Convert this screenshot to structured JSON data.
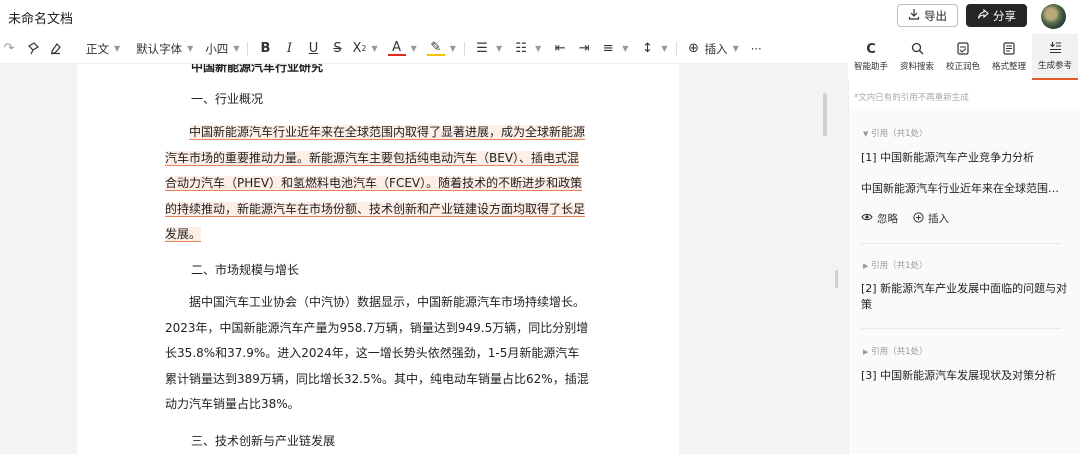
{
  "app": {
    "doc_title": "未命名文档"
  },
  "header": {
    "export_label": "导出",
    "share_label": "分享"
  },
  "toolbar": {
    "paragraph_style": "正文",
    "font_family": "默认字体",
    "font_size": "小四",
    "insert_label": "插入",
    "more_label": "···"
  },
  "side_tabs": [
    {
      "label": "智能助手",
      "icon": "assistant-logo-icon"
    },
    {
      "label": "资料搜索",
      "icon": "search-icon"
    },
    {
      "label": "校正润色",
      "icon": "proofread-icon"
    },
    {
      "label": "格式整理",
      "icon": "format-icon"
    },
    {
      "label": "生成参考",
      "icon": "reference-icon",
      "active": true
    }
  ],
  "document": {
    "clipped_heading": "中国新能源汽车行业研究",
    "section1": "一、行业概况",
    "para1": "中国新能源汽车行业近年来在全球范围内取得了显著进展，成为全球新能源汽车市场的重要推动力量。新能源汽车主要包括纯电动汽车（BEV）、插电式混合动力汽车（PHEV）和氢燃料电池汽车（FCEV）。随着技术的不断进步和政策的持续推动，新能源汽车在市场份额、技术创新和产业链建设方面均取得了长足发展。",
    "section2": "二、市场规模与增长",
    "para2": "据中国汽车工业协会（中汽协）数据显示，中国新能源汽车市场持续增长。2023年，中国新能源汽车产量为958.7万辆，销量达到949.5万辆，同比分别增长35.8%和37.9%。进入2024年，这一增长势头依然强劲，1-5月新能源汽车累计销量达到389万辆，同比增长32.5%。其中，纯电动车销量占比62%，插混动力汽车销量占比38%。",
    "section3": "三、技术创新与产业链发展"
  },
  "panel": {
    "hint": "*文内已有的引用不再重新生成",
    "citations": [
      {
        "count_label": "引用（共1处）",
        "title": "[1] 中国新能源汽车产业竞争力分析",
        "snippet": "中国新能源汽车行业近年来在全球范围内取得了显著进展",
        "ignore_label": "忽略",
        "insert_label": "插入"
      },
      {
        "count_label": "引用（共1处）",
        "title": "[2] 新能源汽车产业发展中面临的问题与对策"
      },
      {
        "count_label": "引用（共1处）",
        "title": "[3] 中国新能源汽车发展现状及对策分析"
      }
    ]
  }
}
